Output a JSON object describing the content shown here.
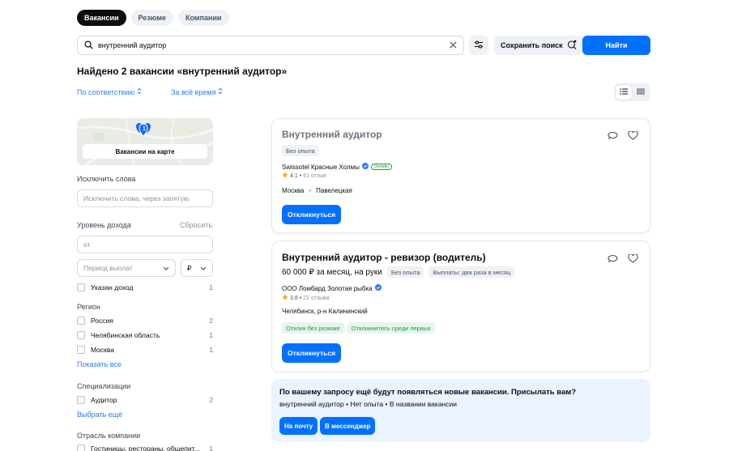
{
  "tabs": [
    "Вакансии",
    "Резюме",
    "Компании"
  ],
  "search": {
    "value": "внутренний аудитор"
  },
  "toolbar": {
    "save_search_label": "Сохранить поиск",
    "find_label": "Найти"
  },
  "results_heading": "Найдено 2 вакансии «внутренний аудитор»",
  "sort": {
    "order_label": "По соответствию",
    "period_label": "За всё время"
  },
  "sidebar": {
    "map_button_label": "Вакансии на карте",
    "map_pin_count": "1",
    "exclude_words": {
      "label": "Исключить слова",
      "placeholder": "Исключить слова, через запятую"
    },
    "income": {
      "label": "Уровень дохода",
      "reset_label": "Сбросить",
      "from_placeholder": "от",
      "period_placeholder": "Период выплат",
      "currency": "₽",
      "indicated_label": "Указан доход",
      "indicated_count": "1"
    },
    "region": {
      "label": "Регион",
      "items": [
        {
          "label": "Россия",
          "count": "2"
        },
        {
          "label": "Челябинская область",
          "count": "1"
        },
        {
          "label": "Москва",
          "count": "1"
        }
      ],
      "show_all_label": "Показать все"
    },
    "specialization": {
      "label": "Специализации",
      "items": [
        {
          "label": "Аудитор",
          "count": "2"
        }
      ],
      "more_label": "Выбрать ещё"
    },
    "industry": {
      "label": "Отрасль компании",
      "items": [
        {
          "label": "Гостиницы, рестораны, общепит...",
          "count": "1"
        }
      ]
    }
  },
  "vacancies": [
    {
      "title": "Внутренний аудитор",
      "experience": "Без опыта",
      "company": "Swissotel Красные Холмы",
      "online_badge": "Онлайн",
      "rating": "4.1",
      "reviews": "61 отзыв",
      "city": "Москва",
      "metro": "Павелецкая",
      "apply_label": "Откликнуться"
    },
    {
      "title": "Внутренний аудитор - ревизор (водитель)",
      "salary": "60 000 ₽ за месяц, на руки",
      "experience": "Без опыта",
      "payouts": "Выплаты: два раза в месяц",
      "company": "ООО Ломбард Золотая рыбка",
      "rating": "3.8",
      "reviews": "22 отзыва",
      "address": "Челябинск, р-н Калининский",
      "tags": [
        "Отклик без резюме",
        "Откликнитесь среди первых"
      ],
      "apply_label": "Откликнуться"
    }
  ],
  "subscribe": {
    "title": "По вашему запросу ещё будут появляться новые вакансии. Присылать вам?",
    "description": "внутренний аудитор • Нет опыта • В названии вакансии",
    "email_button": "На почту",
    "messenger_button": "В мессенджер"
  },
  "colors": {
    "accent": "#0070ff",
    "link": "#2b7bf2",
    "chip_bg": "#eef1f5",
    "positive": "#1e9b45"
  }
}
